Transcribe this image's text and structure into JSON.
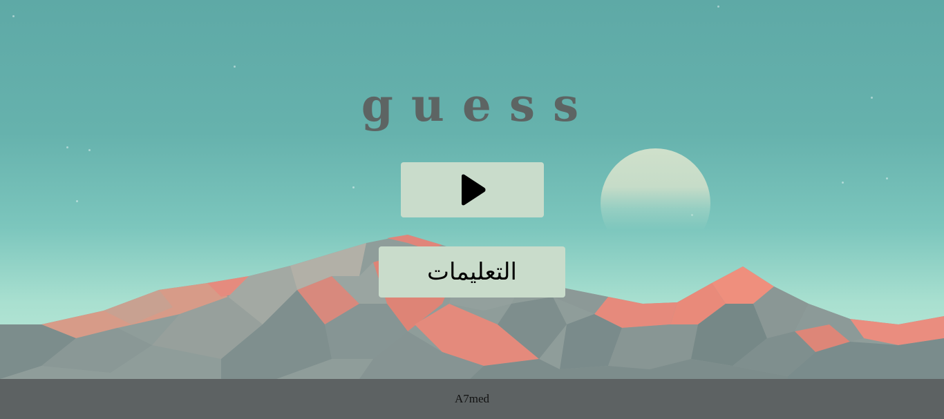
{
  "title": "guess",
  "play_button": {
    "icon": "play-icon"
  },
  "instructions_button": {
    "label": "التعليمات"
  },
  "footer": {
    "author": "A7med"
  },
  "colors": {
    "sky": "#66b2ad",
    "button_bg": "#c9dccb",
    "title_color": "#5d6463",
    "footer_bg": "#5d6263",
    "mountain_gray": "#8f9c99",
    "mountain_coral": "#e0857a"
  }
}
